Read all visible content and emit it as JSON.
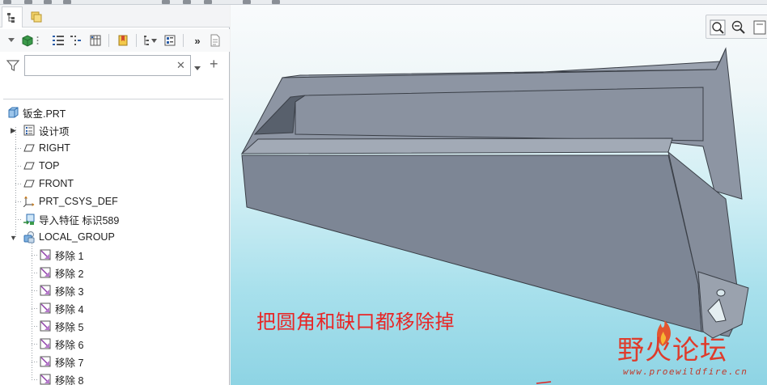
{
  "navigator": {
    "tabs": [
      {
        "name": "model-tree"
      },
      {
        "name": "folder-browser"
      }
    ],
    "search": {
      "value": "",
      "placeholder": ""
    },
    "tree": {
      "root": {
        "label": "钣金.PRT",
        "icon": "part-icon"
      },
      "items": [
        {
          "label": "设计项",
          "icon": "design-items-icon",
          "expandable": true
        },
        {
          "label": "RIGHT",
          "icon": "datum-plane-icon"
        },
        {
          "label": "TOP",
          "icon": "datum-plane-icon"
        },
        {
          "label": "FRONT",
          "icon": "datum-plane-icon"
        },
        {
          "label": "PRT_CSYS_DEF",
          "icon": "csys-icon"
        },
        {
          "label": "导入特征 标识589",
          "icon": "import-feature-icon"
        },
        {
          "label": "LOCAL_GROUP",
          "icon": "group-icon",
          "expanded": true
        }
      ],
      "group_children": [
        {
          "label": "移除 1",
          "icon": "remove-feature-icon"
        },
        {
          "label": "移除 2",
          "icon": "remove-feature-icon"
        },
        {
          "label": "移除 3",
          "icon": "remove-feature-icon"
        },
        {
          "label": "移除 4",
          "icon": "remove-feature-icon"
        },
        {
          "label": "移除 5",
          "icon": "remove-feature-icon"
        },
        {
          "label": "移除 6",
          "icon": "remove-feature-icon"
        },
        {
          "label": "移除 7",
          "icon": "remove-feature-icon"
        },
        {
          "label": "移除 8",
          "icon": "remove-feature-icon"
        }
      ]
    }
  },
  "viewport": {
    "annotation": "把圆角和缺口都移除掉",
    "watermark": {
      "logo": "野火论坛",
      "url": "www.proewildfire.cn"
    },
    "view_tools": [
      "zoom-fit-icon",
      "zoom-out-icon",
      "repaint-icon"
    ]
  },
  "colors": {
    "part_face_main": "#7c8594",
    "part_face_top": "#959dab",
    "annotation": "#e82626",
    "watermark": "#df3b2b"
  }
}
